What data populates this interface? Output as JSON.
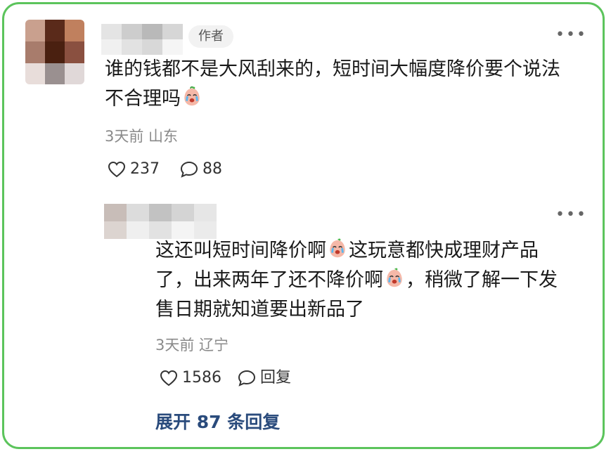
{
  "comment": {
    "author_badge": "作者",
    "text_line1": "谁的钱都不是大风刮来的，短时间大幅度降价要个说法",
    "text_line2": "不合理吗",
    "time_location": "3天前 山东",
    "likes": "237",
    "replies_count": "88",
    "avatar_colors": [
      "#c9a08e",
      "#5a2a1a",
      "#c0805e",
      "#a87c6c",
      "#4a2010",
      "#8a5040",
      "#e8ddda",
      "#9a9090",
      "#e0d8d8"
    ],
    "name_colors": [
      "#e4e4e4",
      "#cdcdcd",
      "#b9b9b9",
      "#d6d6d6",
      "#f0f0f0",
      "#e2e2e2",
      "#d8d8d8",
      "#f5f5f5"
    ]
  },
  "reply": {
    "text_line1_a": "这还叫短时间降价啊",
    "text_line1_b": "这玩意都快成理财产品",
    "text_line2_a": "了，出来两年了还不降价啊",
    "text_line2_b": "，稍微了解一下发",
    "text_line3": "售日期就知道要出新品了",
    "time_location": "3天前 辽宁",
    "likes": "1586",
    "reply_label": "回复",
    "name_colors": [
      "#c8bdb8",
      "#dcdcdc",
      "#c2c2c2",
      "#d4d4d4",
      "#e6e6e6",
      "#dcd4d0",
      "#efefef",
      "#e2e2e2",
      "#f4f4f4",
      "#ebebeb"
    ]
  },
  "more_icon": "more-dots-icon",
  "expand_label": "展开 87 条回复",
  "colors": {
    "frame": "#5cc45c",
    "link": "#2a4b7c",
    "meta": "#8a8a8a"
  }
}
